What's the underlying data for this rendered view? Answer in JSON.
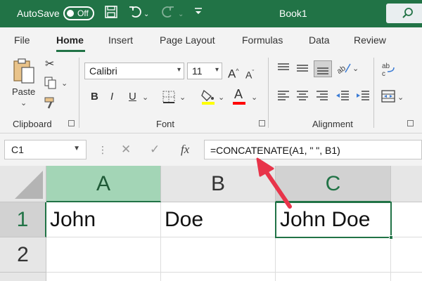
{
  "titlebar": {
    "autosave_label": "AutoSave",
    "autosave_state": "Off",
    "book_title": "Book1",
    "icons": [
      "save-icon",
      "undo-icon",
      "redo-icon",
      "customize-qat-icon",
      "search-icon"
    ]
  },
  "tabs": [
    {
      "label": "File"
    },
    {
      "label": "Home"
    },
    {
      "label": "Insert"
    },
    {
      "label": "Page Layout"
    },
    {
      "label": "Formulas"
    },
    {
      "label": "Data"
    },
    {
      "label": "Review"
    }
  ],
  "ribbon": {
    "clipboard": {
      "paste_label": "Paste",
      "group_label": "Clipboard"
    },
    "font": {
      "name": "Calibri",
      "size": "11",
      "bold": "B",
      "italic": "I",
      "underline": "U",
      "group_label": "Font",
      "font_color_letter": "A",
      "highlight_color": "#ffff00",
      "font_color": "#ff0000"
    },
    "alignment": {
      "group_label": "Alignment"
    }
  },
  "formula_bar": {
    "name_box": "C1",
    "cancel_glyph": "✕",
    "enter_glyph": "✓",
    "fx_label": "fx",
    "formula": "=CONCATENATE(A1, \" \", B1)"
  },
  "sheet": {
    "columns": [
      "A",
      "B",
      "C"
    ],
    "rows": [
      "1",
      "2"
    ],
    "cells": {
      "A1": "John",
      "B1": "Doe",
      "C1": "John Doe"
    },
    "active_cell": "C1"
  },
  "colors": {
    "accent": "#217346",
    "annotation_arrow": "#e8344a"
  }
}
